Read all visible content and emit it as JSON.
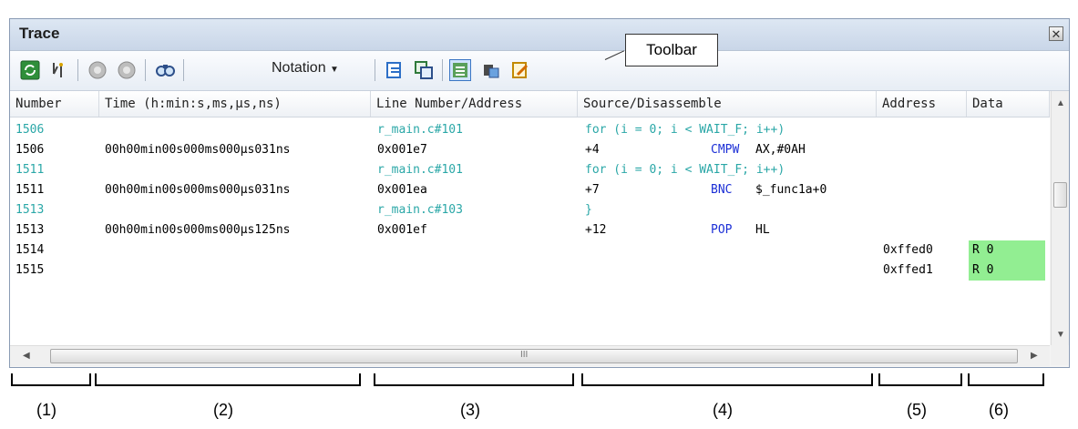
{
  "window": {
    "title": "Trace"
  },
  "toolbar": {
    "notation_label": "Notation",
    "callout_label": "Toolbar",
    "buttons": [
      "refresh-icon",
      "filter-icon",
      "step-back-icon",
      "step-forward-icon",
      "find-icon",
      "link-source-icon",
      "copy-icon",
      "mixed-display-icon",
      "jump-icon",
      "edit-icon"
    ]
  },
  "columns": [
    "Number",
    "Time (h:min:s,ms,μs,ns)",
    "Line Number/Address",
    "Source/Disassemble",
    "Address",
    "Data"
  ],
  "rows": [
    {
      "number": "1506",
      "time": "",
      "line": "r_main.c#101",
      "offset": "",
      "source": "for (i = 0; i < WAIT_F; i++)",
      "mnemonic": "",
      "operand": "",
      "address": "",
      "data": "",
      "kind": "src"
    },
    {
      "number": "1506",
      "time": "00h00min00s000ms000μs031ns",
      "line": "0x001e7",
      "offset": "+4",
      "source": "",
      "mnemonic": "CMPW",
      "operand": "AX,#0AH",
      "address": "",
      "data": "",
      "kind": "asm"
    },
    {
      "number": "1511",
      "time": "",
      "line": "r_main.c#101",
      "offset": "",
      "source": "for (i = 0; i < WAIT_F; i++)",
      "mnemonic": "",
      "operand": "",
      "address": "",
      "data": "",
      "kind": "src"
    },
    {
      "number": "1511",
      "time": "00h00min00s000ms000μs031ns",
      "line": "0x001ea",
      "offset": "+7",
      "source": "",
      "mnemonic": "BNC",
      "operand": "$_func1a+0",
      "address": "",
      "data": "",
      "kind": "asm"
    },
    {
      "number": "1513",
      "time": "",
      "line": "r_main.c#103",
      "offset": "",
      "source": "}",
      "mnemonic": "",
      "operand": "",
      "address": "",
      "data": "",
      "kind": "src"
    },
    {
      "number": "1513",
      "time": "00h00min00s000ms000μs125ns",
      "line": "0x001ef",
      "offset": "+12",
      "source": "",
      "mnemonic": "POP",
      "operand": "HL",
      "address": "",
      "data": "",
      "kind": "asm"
    },
    {
      "number": "1514",
      "time": "",
      "line": "",
      "offset": "",
      "source": "",
      "mnemonic": "",
      "operand": "",
      "address": "0xffed0",
      "data": "R 0",
      "kind": "data"
    },
    {
      "number": "1515",
      "time": "",
      "line": "",
      "offset": "",
      "source": "",
      "mnemonic": "",
      "operand": "",
      "address": "0xffed1",
      "data": "R 0",
      "kind": "data"
    }
  ],
  "scrollbar": {
    "grip": "III"
  },
  "annotations": [
    "(1)",
    "(2)",
    "(3)",
    "(4)",
    "(5)",
    "(6)"
  ],
  "colors": {
    "source_text": "#2aa7a7",
    "mnemonic": "#1c2fd6",
    "data_highlight": "#92ee92"
  }
}
